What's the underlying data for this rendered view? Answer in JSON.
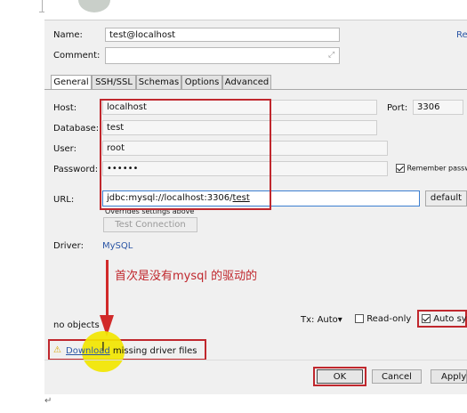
{
  "form": {
    "name_label": "Name:",
    "name_value": "test@localhost",
    "comment_label": "Comment:",
    "right_link": "Re"
  },
  "tabs": [
    {
      "label": "General"
    },
    {
      "label": "SSH/SSL"
    },
    {
      "label": "Schemas"
    },
    {
      "label": "Options"
    },
    {
      "label": "Advanced"
    }
  ],
  "general": {
    "host_label": "Host:",
    "host_value": "localhost",
    "port_label": "Port:",
    "port_value": "3306",
    "database_label": "Database:",
    "database_value": "test",
    "user_label": "User:",
    "user_value": "root",
    "password_label": "Password:",
    "password_value": "••••••",
    "remember_label": "Remember passw",
    "url_label": "URL:",
    "url_value": "jdbc:mysql://localhost:3306/",
    "url_value_db": "test",
    "url_mode": "default",
    "overrides_note": "Overrides settings above",
    "test_connection": "Test Connection",
    "driver_label": "Driver:",
    "driver_value": "MySQL"
  },
  "annotation": {
    "text": "首次是没有mysql 的驱动的",
    "color": "#c0272d"
  },
  "footer": {
    "no_objects": "no objects",
    "tx_label": "Tx: Auto",
    "tx_arrow": "▾",
    "readonly_label": "Read-only",
    "autosync_label": "Auto sy",
    "warning_link": "Download",
    "warning_rest": " missing driver files",
    "ok": "OK",
    "cancel": "Cancel",
    "apply": "Apply"
  },
  "document": {
    "return_mark": "↵"
  },
  "colors": {
    "accent_red": "#c0272d",
    "highlight_yellow": "#f2e600",
    "link_blue": "#2a55a5"
  }
}
